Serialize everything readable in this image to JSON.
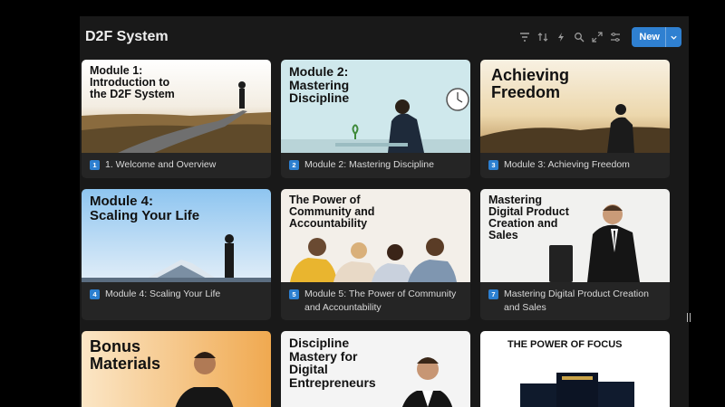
{
  "header": {
    "title": "D2F System",
    "new_label": "New"
  },
  "toolbar_icons": [
    "filter-icon",
    "sort-icon",
    "automation-icon",
    "search-icon",
    "expand-icon",
    "settings-icon"
  ],
  "cards": [
    {
      "cover_text": "Module 1:\nIntroduction to\nthe D2F System",
      "num": "1",
      "caption": "1. Welcome and Overview"
    },
    {
      "cover_text": "Module 2:\nMastering\nDiscipline",
      "num": "2",
      "caption": "Module 2: Mastering Discipline"
    },
    {
      "cover_text": "Achieving\nFreedom",
      "num": "3",
      "caption": "Module 3: Achieving Freedom"
    },
    {
      "cover_text": "Module 4:\nScaling Your Life",
      "num": "4",
      "caption": "Module 4: Scaling Your Life"
    },
    {
      "cover_text": "The Power of\nCommunity and\nAccountability",
      "num": "5",
      "caption": "Module 5: The Power of Community and Accountability"
    },
    {
      "cover_text": "Mastering\nDigital Product\nCreation and\nSales",
      "num": "7",
      "caption": "Mastering Digital Product Creation and Sales"
    },
    {
      "cover_text": "Bonus\nMaterials"
    },
    {
      "cover_text": "Discipline\nMastery for\nDigital\nEntrepreneurs"
    },
    {
      "cover_text": "THE POWER OF FOCUS"
    }
  ],
  "colors": {
    "accent": "#2f80d1",
    "panel": "#191919",
    "card": "#252525"
  }
}
